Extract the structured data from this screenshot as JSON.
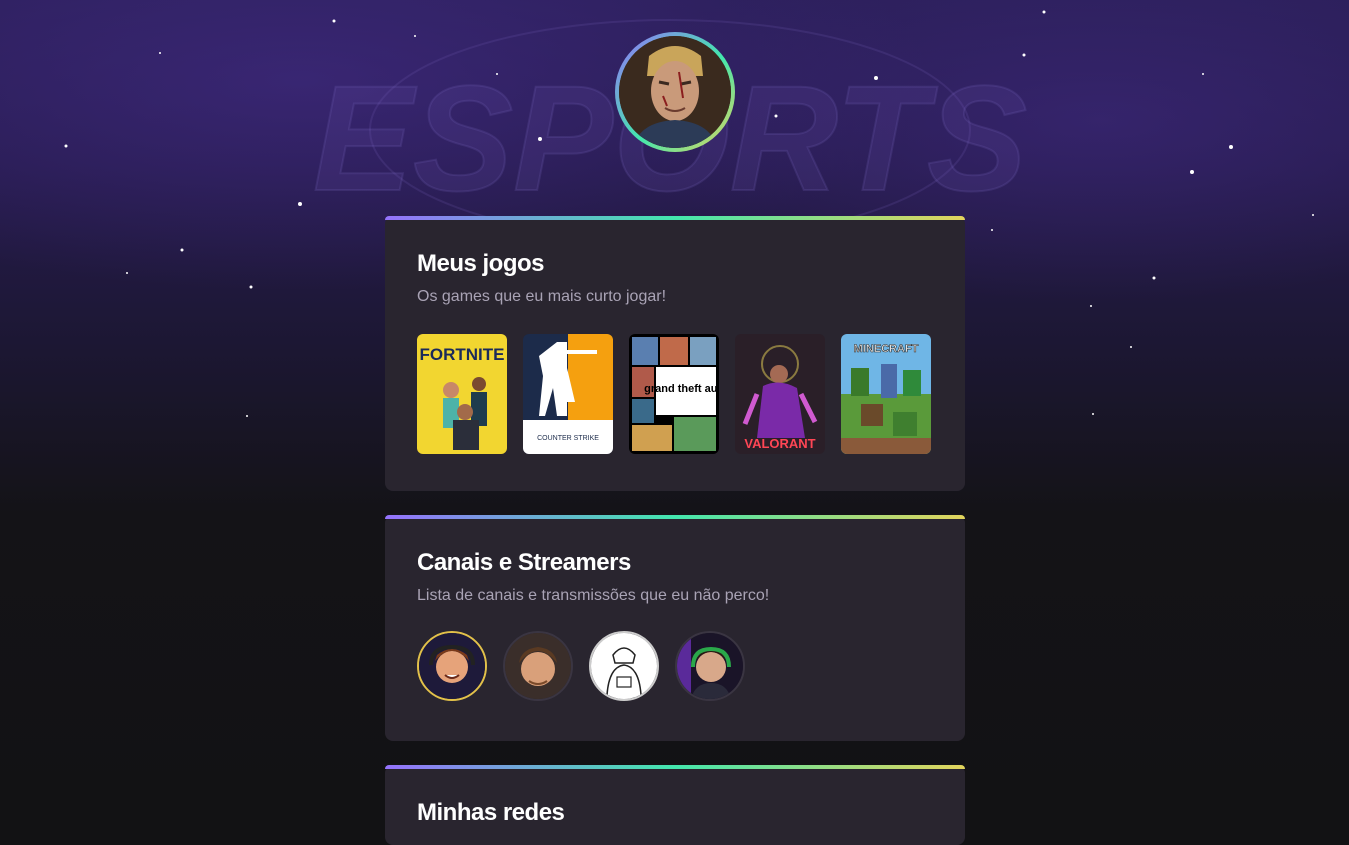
{
  "profile": {
    "avatar_icon": "profile-photo"
  },
  "background": {
    "logo_text": "ESPORTS"
  },
  "sections": {
    "games": {
      "title": "Meus jogos",
      "subtitle": "Os games que eu mais curto jogar!",
      "items": [
        {
          "name": "fortnite-cover",
          "label": "FORTNITE"
        },
        {
          "name": "counter-strike-cover",
          "label": "COUNTER STRIKE"
        },
        {
          "name": "gta-v-cover",
          "label": "grand theft auto"
        },
        {
          "name": "valorant-cover",
          "label": "VALORANT"
        },
        {
          "name": "minecraft-cover",
          "label": "MINECRAFT"
        }
      ]
    },
    "channels": {
      "title": "Canais e Streamers",
      "subtitle": "Lista de canais e transmissões que eu não perco!",
      "items": [
        {
          "name": "streamer-avatar-1"
        },
        {
          "name": "streamer-avatar-2"
        },
        {
          "name": "streamer-avatar-3"
        },
        {
          "name": "streamer-avatar-4"
        }
      ]
    },
    "socials": {
      "title": "Minhas redes"
    }
  },
  "colors": {
    "gradient_start": "#9572fc",
    "gradient_mid": "#43e7ad",
    "gradient_end": "#e2d45c",
    "card_bg": "#29252f",
    "page_bg": "#121214"
  }
}
